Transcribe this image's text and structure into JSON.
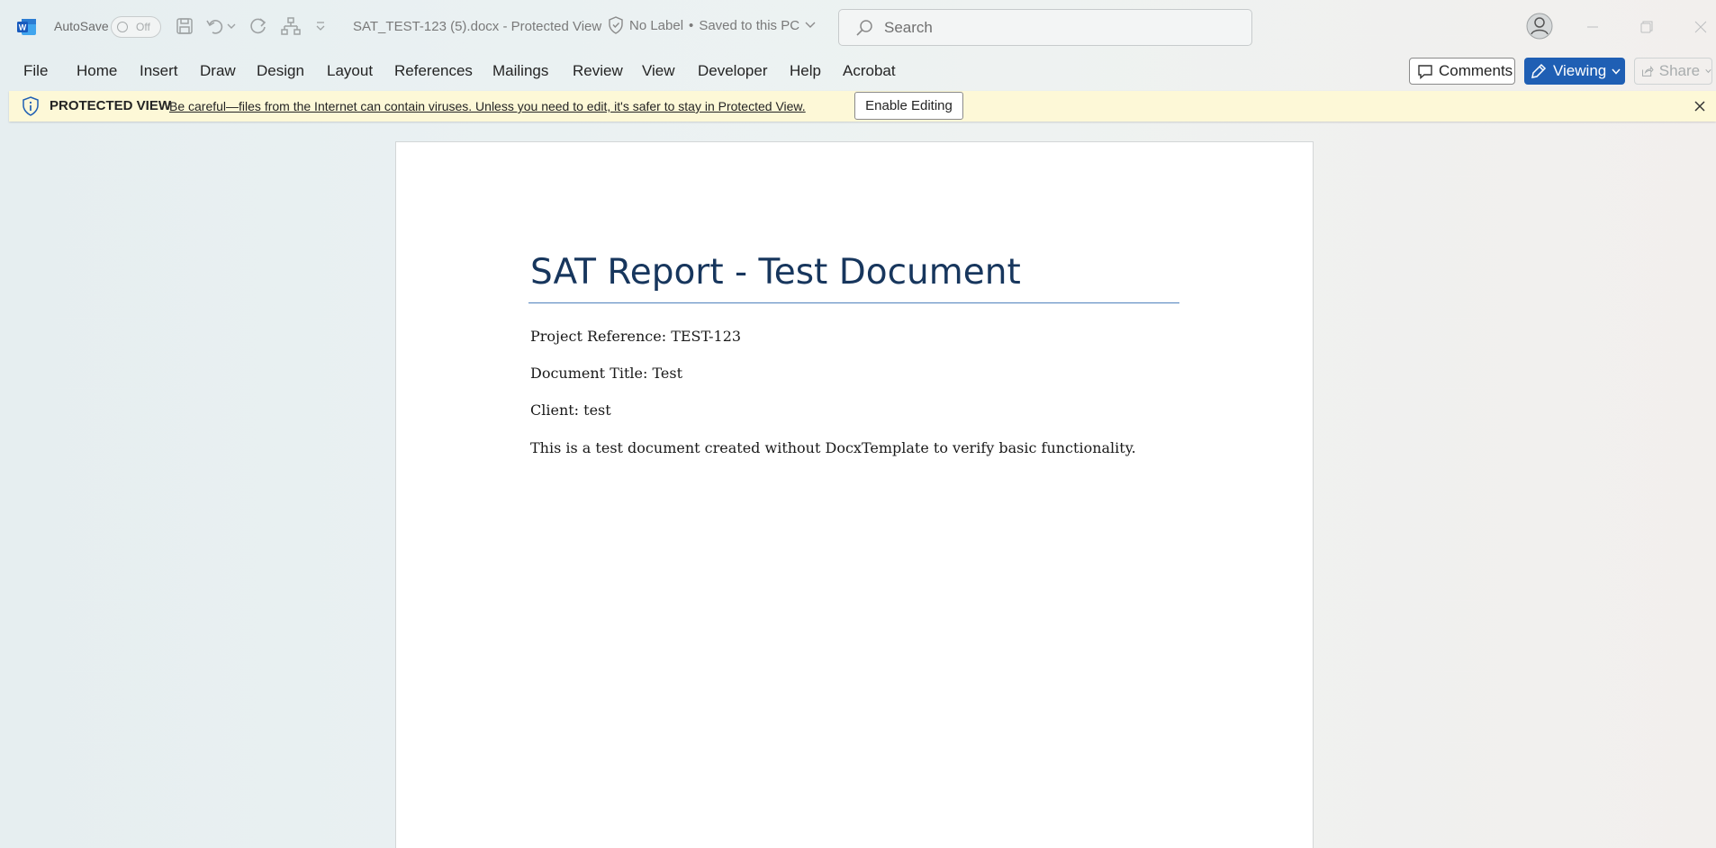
{
  "titlebar": {
    "app_icon": "word-logo-icon",
    "autosave_label": "AutoSave",
    "autosave_state": "Off",
    "document_title": "SAT_TEST-123 (5).docx  -  Protected View",
    "sensitivity_label": "No Label",
    "save_status": "Saved to this PC",
    "search_placeholder": "Search"
  },
  "ribbon": {
    "tabs": [
      "File",
      "Home",
      "Insert",
      "Draw",
      "Design",
      "Layout",
      "References",
      "Mailings",
      "Review",
      "View",
      "Developer",
      "Help",
      "Acrobat"
    ],
    "comments_label": "Comments",
    "viewing_label": "Viewing",
    "share_label": "Share"
  },
  "protected_view": {
    "title": "PROTECTED VIEW",
    "message": "Be careful—files from the Internet can contain viruses. Unless you need to edit, it's safer to stay in Protected View.",
    "enable_label": "Enable Editing"
  },
  "document": {
    "heading": "SAT Report - Test Document",
    "paragraphs": [
      "Project Reference: TEST-123",
      "Document Title: Test",
      "Client: test",
      "This is a test document created without DocxTemplate to verify basic functionality."
    ]
  },
  "colors": {
    "accent": "#1f5fb4",
    "heading": "#17365d",
    "heading_rule": "#4f81bd",
    "protected_bar": "#fdf8d7"
  }
}
